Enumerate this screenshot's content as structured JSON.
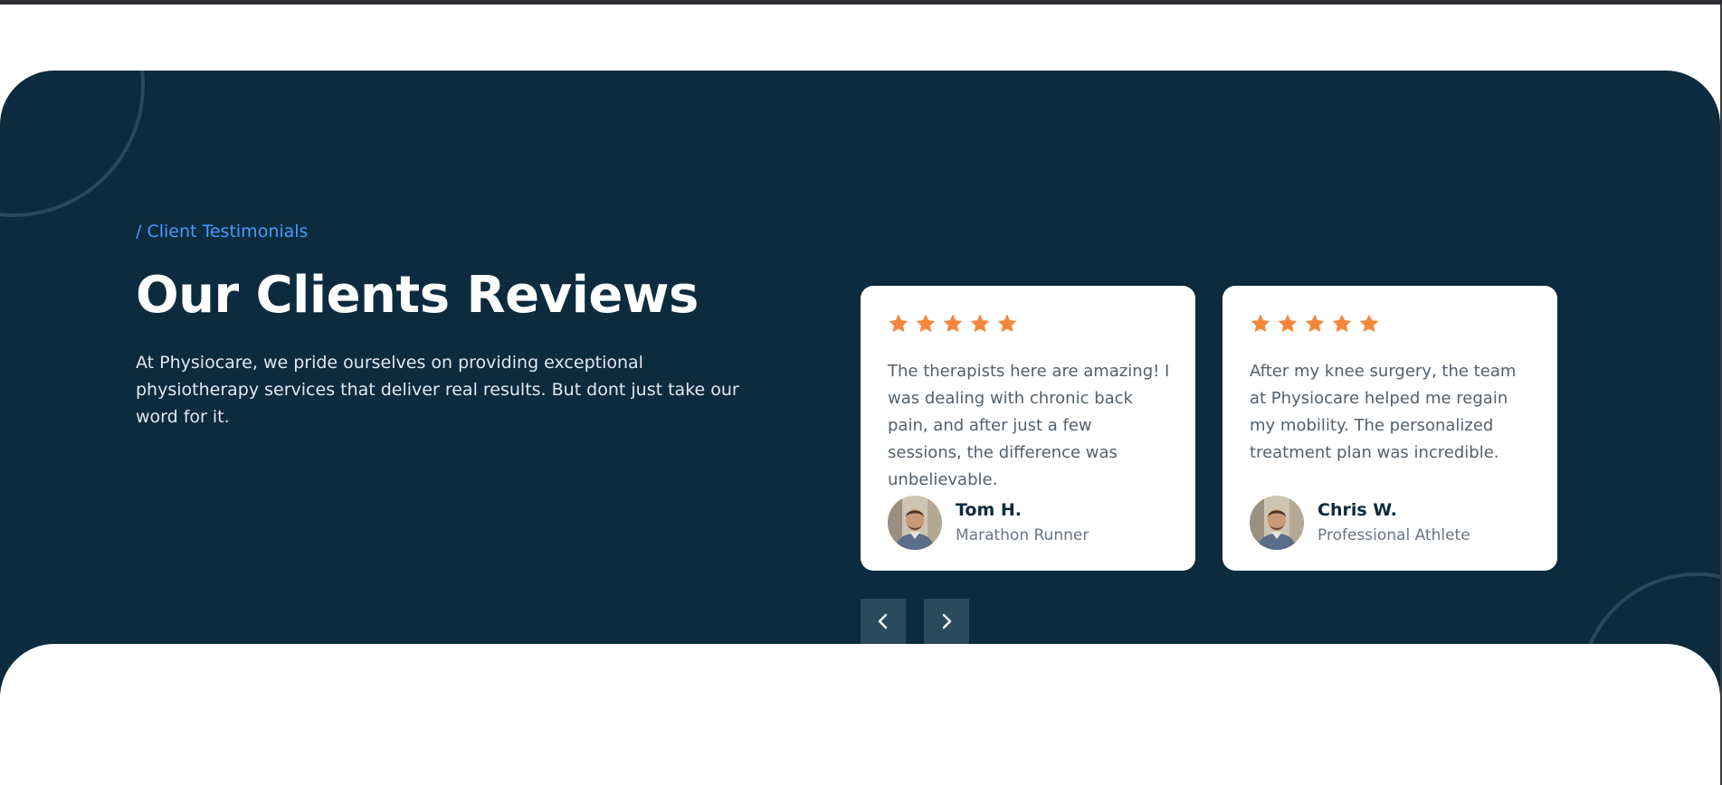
{
  "section": {
    "eyebrow": "/ Client Testimonials",
    "title": "Our Clients Reviews",
    "description": "At Physiocare, we pride ourselves on providing exceptional physiotherapy services that deliver real results. But dont just take our word for it."
  },
  "testimonials": [
    {
      "rating": 5,
      "quote": "The therapists here are amazing! I was dealing with chronic back pain, and after just a few sessions, the difference was unbelievable.",
      "name": "Tom H.",
      "role": "Marathon Runner",
      "avatar_icon": "avatar-photo"
    },
    {
      "rating": 5,
      "quote": "After my knee surgery, the team at Physiocare helped me regain my mobility. The personalized treatment plan was incredible.",
      "name": "Chris W.",
      "role": "Professional Athlete",
      "avatar_icon": "avatar-photo"
    }
  ],
  "controls": {
    "prev_icon": "chevron-left-icon",
    "next_icon": "chevron-right-icon"
  },
  "colors": {
    "section_bg": "#0c2b3e",
    "accent": "#4a9bff",
    "star": "#f5873b",
    "nav_button": "#2a4a5e"
  }
}
